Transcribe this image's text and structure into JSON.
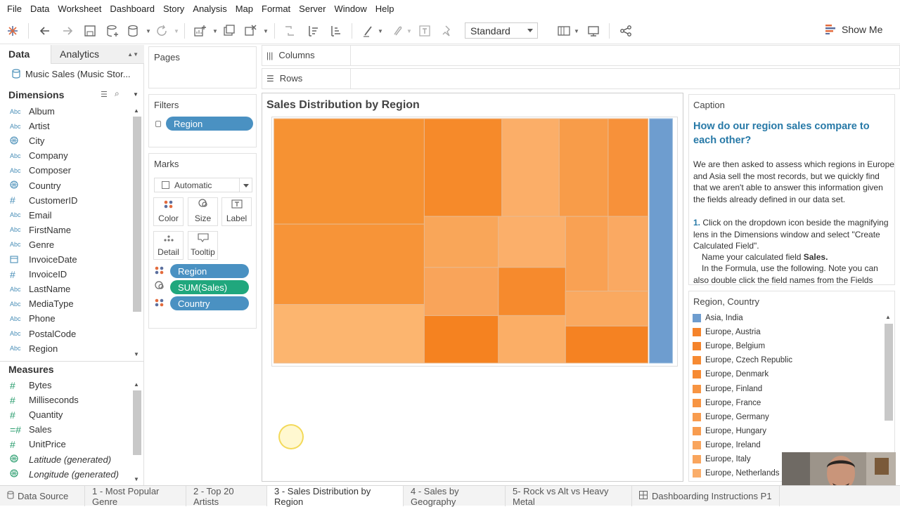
{
  "menu": [
    "File",
    "Data",
    "Worksheet",
    "Dashboard",
    "Story",
    "Analysis",
    "Map",
    "Format",
    "Server",
    "Window",
    "Help"
  ],
  "toolbar": {
    "fit_label": "Standard",
    "show_me_label": "Show Me"
  },
  "data_pane": {
    "tab_data": "Data",
    "tab_analytics": "Analytics",
    "datasource": "Music Sales (Music Stor...",
    "dimensions_header": "Dimensions",
    "dimensions": [
      {
        "type": "Abc",
        "label": "Album"
      },
      {
        "type": "Abc",
        "label": "Artist"
      },
      {
        "type": "geo",
        "label": "City"
      },
      {
        "type": "Abc",
        "label": "Company"
      },
      {
        "type": "Abc",
        "label": "Composer"
      },
      {
        "type": "geo",
        "label": "Country"
      },
      {
        "type": "#",
        "label": "CustomerID"
      },
      {
        "type": "Abc",
        "label": "Email"
      },
      {
        "type": "Abc",
        "label": "FirstName"
      },
      {
        "type": "Abc",
        "label": "Genre"
      },
      {
        "type": "date",
        "label": "InvoiceDate"
      },
      {
        "type": "#",
        "label": "InvoiceID"
      },
      {
        "type": "Abc",
        "label": "LastName"
      },
      {
        "type": "Abc",
        "label": "MediaType"
      },
      {
        "type": "Abc",
        "label": "Phone"
      },
      {
        "type": "Abc",
        "label": "PostalCode"
      },
      {
        "type": "Abc",
        "label": "Region"
      }
    ],
    "measures_header": "Measures",
    "measures": [
      {
        "type": "#",
        "label": "Bytes",
        "italic": false
      },
      {
        "type": "#",
        "label": "Milliseconds",
        "italic": false
      },
      {
        "type": "#",
        "label": "Quantity",
        "italic": false
      },
      {
        "type": "=#",
        "label": "Sales",
        "italic": false
      },
      {
        "type": "#",
        "label": "UnitPrice",
        "italic": false
      },
      {
        "type": "geo",
        "label": "Latitude (generated)",
        "italic": true
      },
      {
        "type": "geo",
        "label": "Longitude (generated)",
        "italic": true
      }
    ]
  },
  "cards": {
    "pages": "Pages",
    "filters": "Filters",
    "filter_pill": "Region",
    "marks": "Marks",
    "mark_type": "Automatic",
    "mark_buttons": [
      "Color",
      "Size",
      "Label",
      "Detail",
      "Tooltip"
    ],
    "mark_pills": [
      "Region",
      "SUM(Sales)",
      "Country"
    ]
  },
  "shelves": {
    "columns": "Columns",
    "rows": "Rows"
  },
  "viz": {
    "title": "Sales Distribution by Region"
  },
  "caption": {
    "header": "Caption",
    "question": "How do our region sales compare to each other?",
    "para1": "We are then asked to assess which regions in Europe and Asia sell the most records, but we quickly find that we aren't able to answer this information given the fields already defined in our data set.",
    "step_num": "1.",
    "step_text": " Click on the dropdown icon beside the magnifying lens in the Dimensions window and select \"Create Calculated Field\".",
    "name_prefix": "Name your calculated field ",
    "name_bold": "Sales.",
    "formula_text": "In the Formula, use the following. Note you can also double click the field names from the Fields"
  },
  "legend": {
    "header": "Region, Country",
    "items": [
      {
        "label": "Asia, India",
        "color": "#6e9dcf"
      },
      {
        "label": "Europe, Austria",
        "color": "#f5832a"
      },
      {
        "label": "Europe, Belgium",
        "color": "#f5832a"
      },
      {
        "label": "Europe, Czech Republic",
        "color": "#f68a32"
      },
      {
        "label": "Europe, Denmark",
        "color": "#f68a32"
      },
      {
        "label": "Europe, Finland",
        "color": "#f79442"
      },
      {
        "label": "Europe, France",
        "color": "#f79442"
      },
      {
        "label": "Europe, Germany",
        "color": "#f89c4f"
      },
      {
        "label": "Europe, Hungary",
        "color": "#f89c4f"
      },
      {
        "label": "Europe, Ireland",
        "color": "#f9a55d"
      },
      {
        "label": "Europe, Italy",
        "color": "#f9a55d"
      },
      {
        "label": "Europe, Netherlands",
        "color": "#faad6a"
      }
    ]
  },
  "bottom_tabs": [
    "Data Source",
    "1 - Most Popular Genre",
    "2 - Top 20 Artists",
    "3 - Sales Distribution by Region",
    "4 - Sales by Geography",
    "5- Rock vs Alt vs Heavy Metal",
    "Dashboarding Instructions P1"
  ],
  "active_tab": "3 - Sales Distribution by Region"
}
